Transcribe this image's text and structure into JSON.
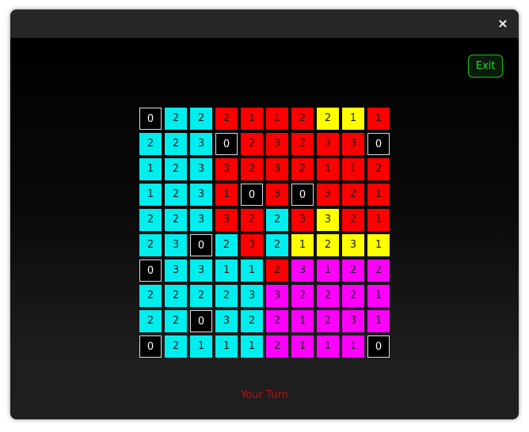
{
  "window": {
    "close_label": "×"
  },
  "exit_label": "Exit",
  "turn_text": "Your Turn",
  "colors": {
    "c": "#00eeee",
    "r": "#ff0000",
    "y": "#ffff00",
    "m": "#ff00ff",
    "k": "#000000"
  },
  "board": [
    [
      [
        "k",
        "0"
      ],
      [
        "c",
        "2"
      ],
      [
        "c",
        "2"
      ],
      [
        "r",
        "2"
      ],
      [
        "r",
        "1"
      ],
      [
        "r",
        "1"
      ],
      [
        "r",
        "2"
      ],
      [
        "y",
        "2"
      ],
      [
        "y",
        "1"
      ],
      [
        "r",
        "1"
      ]
    ],
    [
      [
        "c",
        "2"
      ],
      [
        "c",
        "2"
      ],
      [
        "c",
        "3"
      ],
      [
        "k",
        "0"
      ],
      [
        "r",
        "2"
      ],
      [
        "r",
        "3"
      ],
      [
        "r",
        "2"
      ],
      [
        "r",
        "3"
      ],
      [
        "r",
        "3"
      ],
      [
        "k",
        "0"
      ]
    ],
    [
      [
        "c",
        "1"
      ],
      [
        "c",
        "2"
      ],
      [
        "c",
        "3"
      ],
      [
        "r",
        "3"
      ],
      [
        "r",
        "2"
      ],
      [
        "r",
        "3"
      ],
      [
        "r",
        "2"
      ],
      [
        "r",
        "1"
      ],
      [
        "r",
        "1"
      ],
      [
        "r",
        "2"
      ]
    ],
    [
      [
        "c",
        "1"
      ],
      [
        "c",
        "2"
      ],
      [
        "c",
        "3"
      ],
      [
        "r",
        "1"
      ],
      [
        "k",
        "0"
      ],
      [
        "r",
        "3"
      ],
      [
        "k",
        "0"
      ],
      [
        "r",
        "3"
      ],
      [
        "r",
        "2"
      ],
      [
        "r",
        "1"
      ]
    ],
    [
      [
        "c",
        "2"
      ],
      [
        "c",
        "2"
      ],
      [
        "c",
        "3"
      ],
      [
        "r",
        "3"
      ],
      [
        "r",
        "2"
      ],
      [
        "c",
        "2"
      ],
      [
        "r",
        "3"
      ],
      [
        "y",
        "3"
      ],
      [
        "r",
        "2"
      ],
      [
        "r",
        "1"
      ]
    ],
    [
      [
        "c",
        "2"
      ],
      [
        "c",
        "3"
      ],
      [
        "k",
        "0"
      ],
      [
        "c",
        "2"
      ],
      [
        "r",
        "3"
      ],
      [
        "c",
        "2"
      ],
      [
        "y",
        "1"
      ],
      [
        "y",
        "2"
      ],
      [
        "y",
        "3"
      ],
      [
        "y",
        "1"
      ]
    ],
    [
      [
        "k",
        "0"
      ],
      [
        "c",
        "3"
      ],
      [
        "c",
        "3"
      ],
      [
        "c",
        "1"
      ],
      [
        "c",
        "1"
      ],
      [
        "r",
        "2"
      ],
      [
        "m",
        "3"
      ],
      [
        "m",
        "1"
      ],
      [
        "m",
        "2"
      ],
      [
        "m",
        "2"
      ]
    ],
    [
      [
        "c",
        "2"
      ],
      [
        "c",
        "2"
      ],
      [
        "c",
        "2"
      ],
      [
        "c",
        "2"
      ],
      [
        "c",
        "3"
      ],
      [
        "m",
        "3"
      ],
      [
        "m",
        "2"
      ],
      [
        "m",
        "2"
      ],
      [
        "m",
        "2"
      ],
      [
        "m",
        "1"
      ]
    ],
    [
      [
        "c",
        "2"
      ],
      [
        "c",
        "2"
      ],
      [
        "k",
        "0"
      ],
      [
        "c",
        "3"
      ],
      [
        "c",
        "2"
      ],
      [
        "m",
        "2"
      ],
      [
        "m",
        "1"
      ],
      [
        "m",
        "2"
      ],
      [
        "m",
        "3"
      ],
      [
        "m",
        "1"
      ]
    ],
    [
      [
        "k",
        "0"
      ],
      [
        "c",
        "2"
      ],
      [
        "c",
        "1"
      ],
      [
        "c",
        "1"
      ],
      [
        "c",
        "1"
      ],
      [
        "m",
        "2"
      ],
      [
        "m",
        "1"
      ],
      [
        "m",
        "1"
      ],
      [
        "m",
        "1"
      ],
      [
        "k",
        "0"
      ]
    ]
  ]
}
